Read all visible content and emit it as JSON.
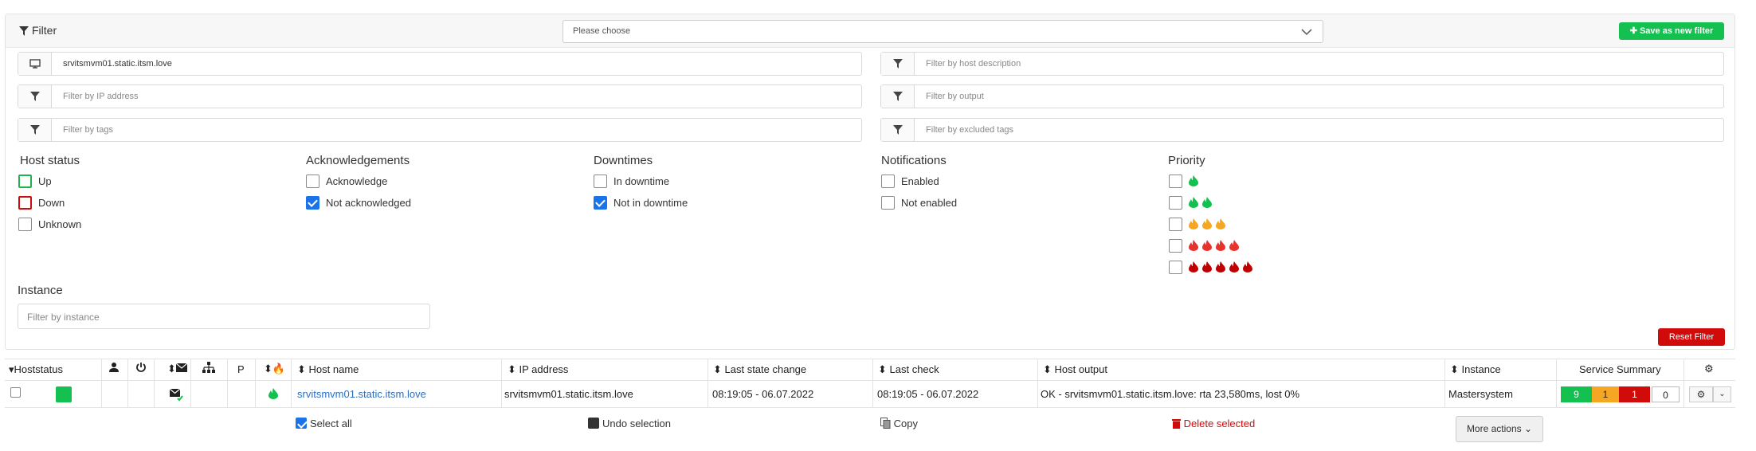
{
  "filter": {
    "title": "Filter",
    "choose_placeholder": "Please choose",
    "save_label": "Save as new filter",
    "reset_label": "Reset Filter",
    "fields": {
      "host": "srvitsmvm01.static.itsm.love",
      "host_description": "Filter by host description",
      "ip": "Filter by IP address",
      "output": "Filter by output",
      "tags": "Filter by tags",
      "excluded_tags": "Filter by excluded tags"
    },
    "host_status": {
      "title": "Host status",
      "up": "Up",
      "down": "Down",
      "unknown": "Unknown"
    },
    "acknowledgements": {
      "title": "Acknowledgements",
      "ack": "Acknowledge",
      "not_ack": "Not acknowledged",
      "not_ack_checked": true
    },
    "downtimes": {
      "title": "Downtimes",
      "in": "In downtime",
      "not_in": "Not in downtime",
      "not_in_checked": true
    },
    "notifications": {
      "title": "Notifications",
      "enabled": "Enabled",
      "not_enabled": "Not enabled"
    },
    "priority": {
      "title": "Priority",
      "levels": [
        1,
        2,
        3,
        4,
        5
      ]
    },
    "instance": {
      "title": "Instance",
      "placeholder": "Filter by instance"
    }
  },
  "table": {
    "headers": {
      "hoststatus": "Hoststatus",
      "p": "P",
      "host_name": "Host name",
      "ip": "IP address",
      "last_state_change": "Last state change",
      "last_check": "Last check",
      "host_output": "Host output",
      "instance": "Instance",
      "service_summary": "Service Summary"
    },
    "rows": [
      {
        "host_name": "srvitsmvm01.static.itsm.love",
        "ip": "srvitsmvm01.static.itsm.love",
        "last_state_change": "08:19:05 - 06.07.2022",
        "last_check": "08:19:05 - 06.07.2022",
        "output": "OK - srvitsmvm01.static.itsm.love: rta 23,580ms, lost 0%",
        "instance": "Mastersystem",
        "summary": {
          "ok": "9",
          "warning": "1",
          "critical": "1",
          "unknown": "0"
        }
      }
    ]
  },
  "actions": {
    "select_all": "Select all",
    "undo": "Undo selection",
    "copy": "Copy",
    "delete": "Delete selected",
    "more": "More actions"
  },
  "colors": {
    "green": "#14c04f",
    "red": "#d10a0a",
    "orange": "#f5a623",
    "link": "#2c6fc2",
    "blue": "#1a73e8"
  }
}
